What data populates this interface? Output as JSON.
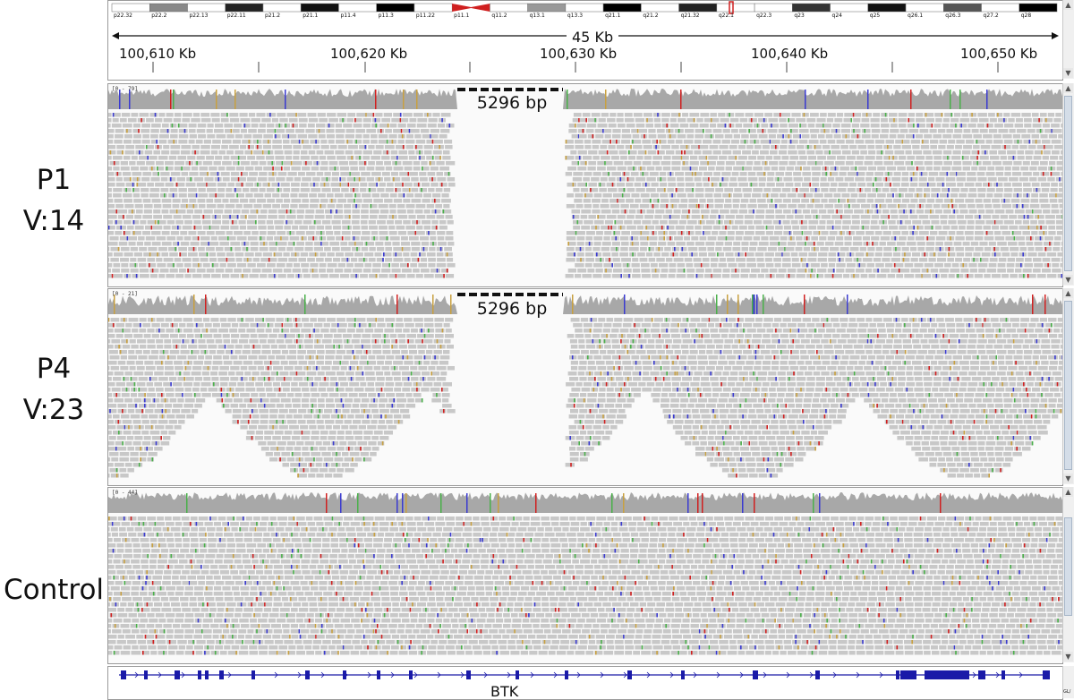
{
  "ideogram": {
    "bands": [
      "p22.32",
      "p22.2",
      "p22.13",
      "p22.11",
      "p21.2",
      "p21.1",
      "p11.4",
      "p11.3",
      "p11.22",
      "p11.1",
      "q11.2",
      "q13.1",
      "q13.3",
      "q21.1",
      "q21.2",
      "q21.32",
      "q22.1",
      "q22.3",
      "q23",
      "q24",
      "q25",
      "q26.1",
      "q26.3",
      "q27.2",
      "q28"
    ]
  },
  "ruler": {
    "span_label": "45 Kb",
    "ticks": [
      "100,610 Kb",
      "100,620 Kb",
      "100,630 Kb",
      "100,640 Kb",
      "100,650 Kb"
    ]
  },
  "panels": [
    {
      "sample_name": "P1",
      "variant_label": "V:14",
      "coverage_range": "[0 - 79]",
      "deletion_label": "5296 bp"
    },
    {
      "sample_name": "P4",
      "variant_label": "V:23",
      "coverage_range": "[0 - 21]",
      "deletion_label": "5296 bp"
    },
    {
      "sample_name": "Control",
      "variant_label": "",
      "coverage_range": "[0 - 44]",
      "deletion_label": ""
    }
  ],
  "gene_track": {
    "gene_name": "BTK",
    "side_label": "GL/"
  },
  "colors": {
    "coverage": "#a8a8a8",
    "read": "#c8c8c8",
    "mismatch_a": "#4ab04a",
    "mismatch_c": "#3a3ad0",
    "mismatch_g": "#c8a040",
    "mismatch_t": "#d02020",
    "gene": "#1a1aa8",
    "centromere": "#d02020"
  }
}
